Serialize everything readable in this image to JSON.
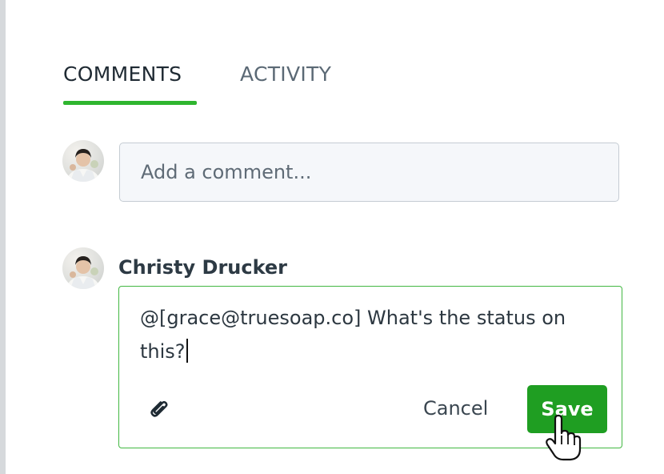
{
  "tabs": [
    {
      "label": "COMMENTS",
      "active": true
    },
    {
      "label": "ACTIVITY",
      "active": false
    }
  ],
  "new_comment": {
    "placeholder": "Add a comment...",
    "value": ""
  },
  "comment": {
    "author": "Christy Drucker",
    "draft_text": "@[grace@truesoap.co] What's the status on this?",
    "cancel_label": "Cancel",
    "save_label": "Save"
  },
  "icons": {
    "avatar": "user-photo",
    "attach": "paperclip-icon",
    "pointer": "hand-cursor-icon"
  },
  "colors": {
    "accent_green": "#2fb52f",
    "save_button": "#1f9e22",
    "focus_border": "#42b842"
  }
}
